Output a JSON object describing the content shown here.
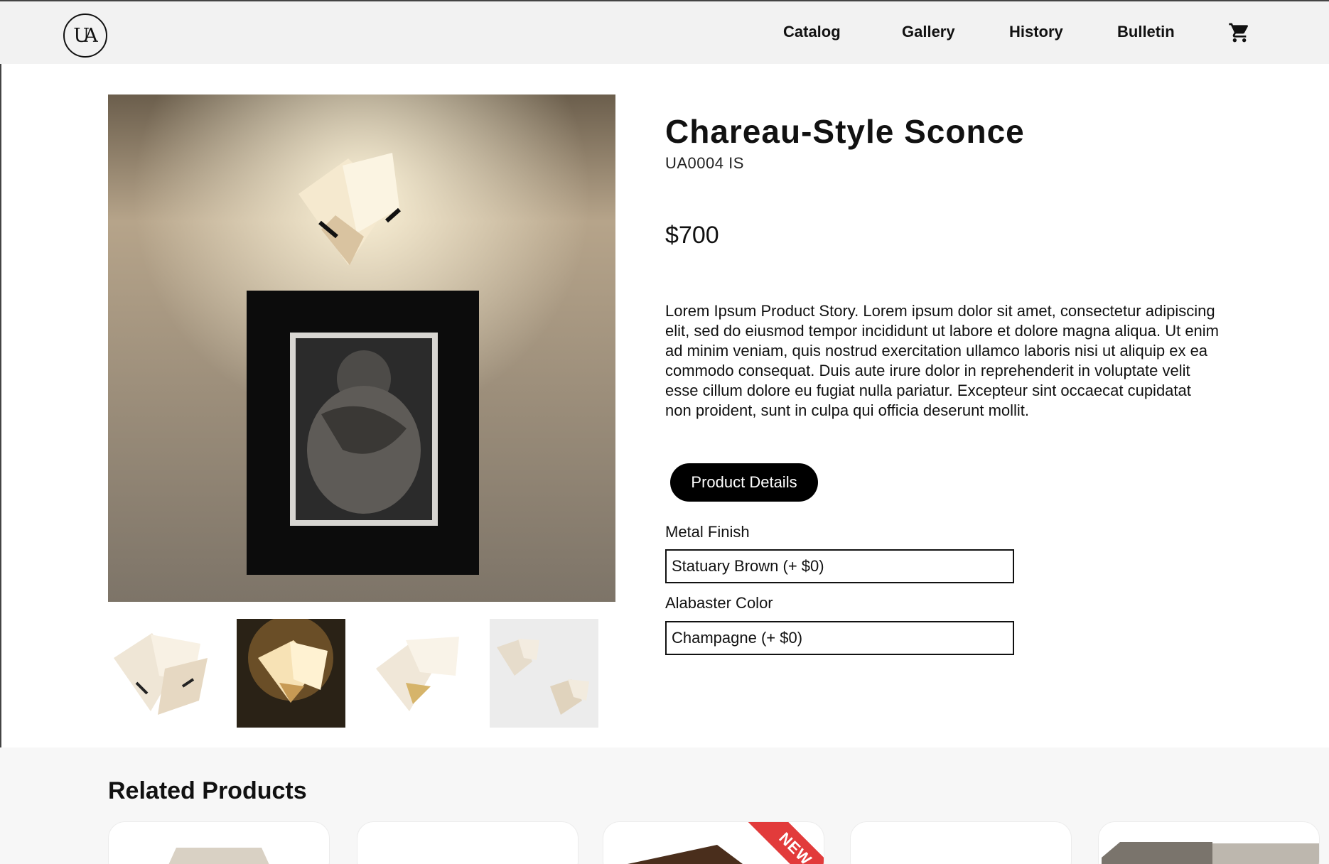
{
  "header": {
    "logo_text": "UA",
    "nav": [
      "Catalog",
      "Gallery",
      "History",
      "Bulletin"
    ],
    "cart_icon": "cart-icon"
  },
  "product": {
    "title": "Chareau-Style Sconce",
    "sku": "UA0004 IS",
    "price": "$700",
    "description": "Lorem Ipsum Product Story. Lorem ipsum dolor sit amet, consectetur adipiscing elit, sed do eiusmod tempor incididunt ut labore et dolore magna aliqua. Ut enim ad minim veniam, quis nostrud exercitation ullamco laboris nisi ut aliquip ex ea commodo consequat. Duis aute irure dolor in reprehenderit in voluptate velit esse cillum dolore eu fugiat nulla pariatur. Excepteur sint occaecat cupidatat non proident, sunt in culpa qui officia deserunt mollit.",
    "details_button": "Product Details",
    "options": [
      {
        "label": "Metal Finish",
        "value": "Statuary Brown (+ $0)"
      },
      {
        "label": "Alabaster Color",
        "value": "Champagne (+ $0)"
      }
    ]
  },
  "related": {
    "title": "Related Products",
    "ribbon_text": "NEW"
  }
}
